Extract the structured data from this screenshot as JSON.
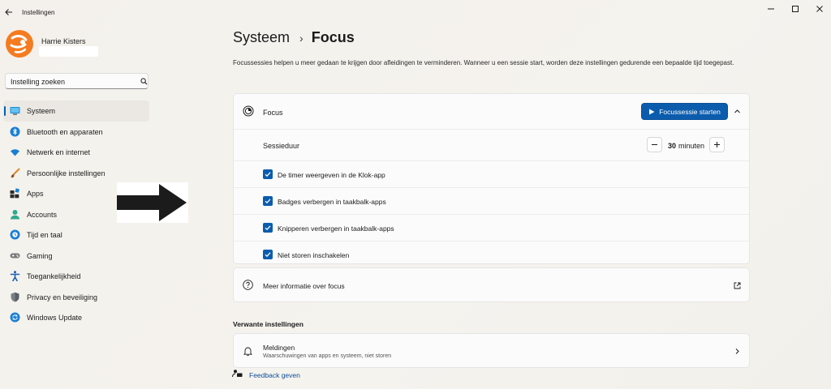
{
  "app": {
    "title": "Instellingen"
  },
  "user": {
    "name": "Harrie Kisters"
  },
  "search": {
    "placeholder": "Instelling zoeken"
  },
  "sidebar": {
    "items": [
      {
        "label": "Systeem",
        "icon": "system-icon",
        "active": true
      },
      {
        "label": "Bluetooth en apparaten",
        "icon": "bluetooth-icon"
      },
      {
        "label": "Netwerk en internet",
        "icon": "wifi-icon"
      },
      {
        "label": "Persoonlijke instellingen",
        "icon": "brush-icon"
      },
      {
        "label": "Apps",
        "icon": "apps-icon"
      },
      {
        "label": "Accounts",
        "icon": "accounts-icon"
      },
      {
        "label": "Tijd en taal",
        "icon": "globe-icon"
      },
      {
        "label": "Gaming",
        "icon": "gamepad-icon"
      },
      {
        "label": "Toegankelijkheid",
        "icon": "accessibility-icon"
      },
      {
        "label": "Privacy en beveiliging",
        "icon": "shield-icon"
      },
      {
        "label": "Windows Update",
        "icon": "update-icon"
      }
    ]
  },
  "breadcrumb": {
    "parent": "Systeem",
    "current": "Focus"
  },
  "description": "Focussessies helpen u meer gedaan te krijgen door afleidingen te verminderen. Wanneer u een sessie start, worden deze instellingen gedurende een bepaalde tijd toegepast.",
  "focus": {
    "label": "Focus",
    "start_button": "Focussessie starten",
    "duration_label": "Sessieduur",
    "duration_value": "30",
    "duration_unit": "minuten",
    "options": [
      {
        "label": "De timer weergeven in de Klok-app",
        "checked": true
      },
      {
        "label": "Badges verbergen in taakbalk-apps",
        "checked": true
      },
      {
        "label": "Knipperen verbergen in taakbalk-apps",
        "checked": true
      },
      {
        "label": "Niet storen inschakelen",
        "checked": true
      }
    ]
  },
  "info": {
    "label": "Meer informatie over focus"
  },
  "related": {
    "heading": "Verwante instellingen",
    "notifications": {
      "title": "Meldingen",
      "subtitle": "Waarschuwingen van apps en systeem, niet storen"
    }
  },
  "feedback": {
    "label": "Feedback geven"
  },
  "colors": {
    "accent": "#0b5cad",
    "background": "#f4f2ed"
  }
}
